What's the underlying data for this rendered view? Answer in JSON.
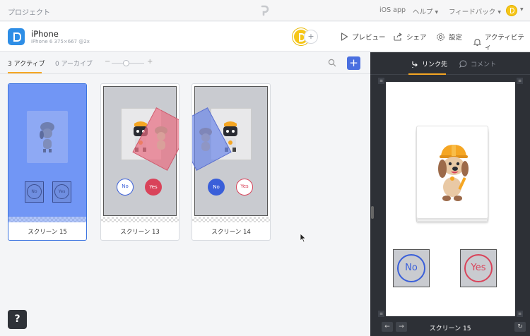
{
  "topbar": {
    "project_label": "プロジェクト",
    "menu": [
      {
        "label": "iOS app",
        "caret": false
      },
      {
        "label": "ヘルプ",
        "caret": true
      },
      {
        "label": "フィードバック",
        "caret": true
      }
    ]
  },
  "header": {
    "device_name": "iPhone",
    "device_meta": "iPhone 6   375×667 @2x",
    "add_collaborator": "+",
    "actions": {
      "preview": "プレビュー",
      "share": "シェア",
      "settings": "設定",
      "activity": "アクティビティ"
    }
  },
  "tabs": {
    "active": "3 アクティブ",
    "archive": "0 アーカイブ",
    "zoom_minus": "−",
    "zoom_plus": "+",
    "zoom_level": 0.45,
    "add": "+"
  },
  "screens": [
    {
      "name": "スクリーン 15",
      "selected": true
    },
    {
      "name": "スクリーン 13",
      "selected": false,
      "no": "No",
      "yes": "Yes"
    },
    {
      "name": "スクリーン 14",
      "selected": false,
      "no": "No",
      "yes": "Yes"
    }
  ],
  "screen15_buttons": {
    "no": "No",
    "yes": "Yes"
  },
  "help": "?",
  "right_panel": {
    "tab_links": "リンク先",
    "tab_comments": "コメント",
    "preview_no": "No",
    "preview_yes": "Yes",
    "prev": "←",
    "next": "→",
    "current_screen": "スクリーン 15"
  },
  "colors": {
    "accent": "#f5a623",
    "selection": "#4a6fe0",
    "no_ring": "#3a5fd9",
    "yes_ring": "#d9435a",
    "dark_panel": "#2d3036"
  }
}
